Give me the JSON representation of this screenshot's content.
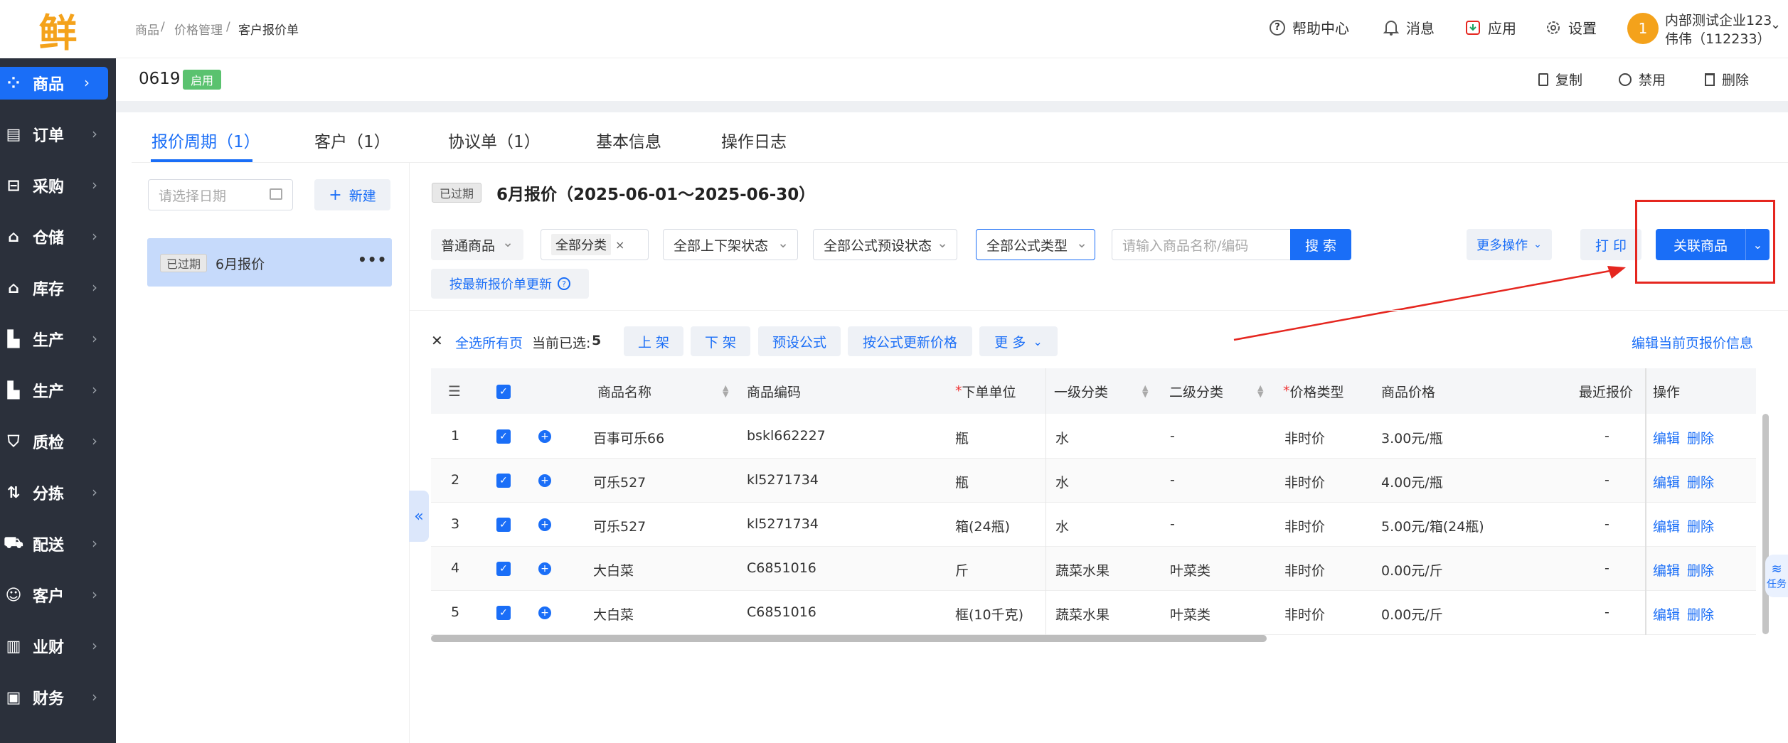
{
  "logo": "鲜",
  "sidebar": {
    "items": [
      {
        "label": "商品",
        "icon": "grid-icon"
      },
      {
        "label": "订单",
        "icon": "clipboard-icon"
      },
      {
        "label": "采购",
        "icon": "basket-icon"
      },
      {
        "label": "仓储",
        "icon": "warehouse-icon"
      },
      {
        "label": "库存",
        "icon": "home-stock-icon"
      },
      {
        "label": "生产",
        "icon": "factory-icon"
      },
      {
        "label": "生产",
        "icon": "factory-icon"
      },
      {
        "label": "质检",
        "icon": "shield-icon"
      },
      {
        "label": "分拣",
        "icon": "sort-icon"
      },
      {
        "label": "配送",
        "icon": "truck-icon"
      },
      {
        "label": "客户",
        "icon": "user-icon"
      },
      {
        "label": "业财",
        "icon": "chart-icon"
      },
      {
        "label": "财务",
        "icon": "wallet-icon"
      }
    ]
  },
  "breadcrumb": {
    "items": [
      "商品",
      "价格管理",
      "客户报价单"
    ],
    "sep": "/"
  },
  "header": {
    "help": "帮助中心",
    "messages": "消息",
    "apps": "应用",
    "settings": "设置",
    "avatar_text": "1",
    "company": "内部测试企业123",
    "user": "伟伟（112233）"
  },
  "title": {
    "name": "0619",
    "status": "启用",
    "copy": "复制",
    "disable": "禁用",
    "delete": "删除"
  },
  "tabs": [
    "报价周期（1）",
    "客户（1）",
    "协议单（1）",
    "基本信息",
    "操作日志"
  ],
  "left": {
    "date_placeholder": "请选择日期",
    "new_label": "新建",
    "period_tag": "已过期",
    "period_name": "6月报价",
    "more": "•••"
  },
  "detail": {
    "tag": "已过期",
    "title": "6月报价（2025-06-01～2025-06-30）"
  },
  "filters": {
    "goods_type": "普通商品",
    "category": "全部分类",
    "shelf": "全部上下架状态",
    "formula_status": "全部公式预设状态",
    "formula_type": "全部公式类型",
    "search_placeholder": "请输入商品名称/编码",
    "search_btn": "搜 索",
    "more_ops": "更多操作",
    "print": "打 印",
    "link_goods": "关联商品",
    "update_latest": "按最新报价单更新"
  },
  "bulk": {
    "select_all": "全选所有页",
    "selected_label": "当前已选:",
    "selected_count": "5",
    "on_shelf": "上 架",
    "off_shelf": "下 架",
    "preset_formula": "预设公式",
    "update_by_formula": "按公式更新价格",
    "more": "更 多",
    "edit_page": "编辑当前页报价信息"
  },
  "table": {
    "columns": [
      "商品名称",
      "商品编码",
      "下单单位",
      "一级分类",
      "二级分类",
      "价格类型",
      "商品价格",
      "最近报价",
      "操作"
    ],
    "edit": "编辑",
    "remove": "删除",
    "rows": [
      {
        "no": "1",
        "name": "百事可乐66",
        "code": "bskl662227",
        "unit": "瓶",
        "cat1": "水",
        "cat2": "-",
        "ptype": "非时价",
        "price": "3.00元/瓶",
        "recent": "-"
      },
      {
        "no": "2",
        "name": "可乐527",
        "code": "kl5271734",
        "unit": "瓶",
        "cat1": "水",
        "cat2": "-",
        "ptype": "非时价",
        "price": "4.00元/瓶",
        "recent": "-"
      },
      {
        "no": "3",
        "name": "可乐527",
        "code": "kl5271734",
        "unit": "箱(24瓶)",
        "cat1": "水",
        "cat2": "-",
        "ptype": "非时价",
        "price": "5.00元/箱(24瓶)",
        "recent": "-"
      },
      {
        "no": "4",
        "name": "大白菜",
        "code": "C6851016",
        "unit": "斤",
        "cat1": "蔬菜水果",
        "cat2": "叶菜类",
        "ptype": "非时价",
        "price": "0.00元/斤",
        "recent": "-"
      },
      {
        "no": "5",
        "name": "大白菜",
        "code": "C6851016",
        "unit": "框(10千克)",
        "cat1": "蔬菜水果",
        "cat2": "叶菜类",
        "ptype": "非时价",
        "price": "0.00元/斤",
        "recent": "-"
      }
    ]
  },
  "float_task": "任务",
  "colors": {
    "accent": "#1a6ef7",
    "annotation": "#e5261f",
    "sidebar": "#2b303b"
  }
}
